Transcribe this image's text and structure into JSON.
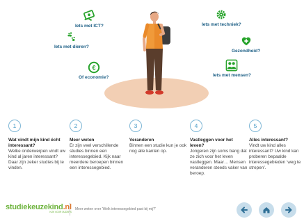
{
  "interests": [
    {
      "icon": "hands-with-money-icon",
      "label": "Iets met ICT?"
    },
    {
      "icon": "paw-prints-icon",
      "label": "Iets met dieren?"
    },
    {
      "icon": "euro-coin-icon",
      "label": "Of economie?"
    },
    {
      "icon": "gear-icon",
      "label": "Iets met techniek?"
    },
    {
      "icon": "heart-cross-icon",
      "label": "Gezondheid?"
    },
    {
      "icon": "people-icon",
      "label": "Iets met mensen?"
    }
  ],
  "steps": [
    {
      "number": "1",
      "title": "Wat vindt mijn kind écht interessant?",
      "body": "Welke onderwerpen vindt uw kind al jaren interessant? Daar zijn zeker studies bij te vinden."
    },
    {
      "number": "2",
      "title": "Meer weten",
      "body": "Er zijn veel verschillende studies binnen een interessegebied. Kijk naar meerdere beroepen binnen een interessegebied."
    },
    {
      "number": "3",
      "title": "Veranderen",
      "body": "Binnen een studie kun je ook nog alle kanten op."
    },
    {
      "number": "4",
      "title": "Vastleggen voor het leven?",
      "body": "Jongeren zijn soms bang dat ze zich voor het leven vastleggen. Maar… Mensen veranderen steeds vaker van beroep."
    },
    {
      "number": "5",
      "title": "Alles interessant?",
      "body": "Vindt uw kind alles interessant? Uw kind kan proberen bepaalde interessegebieden ‘weg te strepen’."
    }
  ],
  "footer": {
    "logo_main": "studiekeuzekind",
    "logo_dot": ".nl",
    "logo_tagline": "KIJK VOOR OUDERS",
    "more_text": "Meer weten over 'Welk interessegebied past bij mij?'"
  },
  "nav": {
    "back_icon": "arrow-left-icon",
    "home_icon": "home-icon",
    "next_icon": "arrow-right-icon"
  },
  "colors": {
    "green": "#27a32b",
    "accent_blue": "#4a9cc8",
    "floor": "#f2cfb4",
    "nav_bg": "#c7ddeb"
  }
}
